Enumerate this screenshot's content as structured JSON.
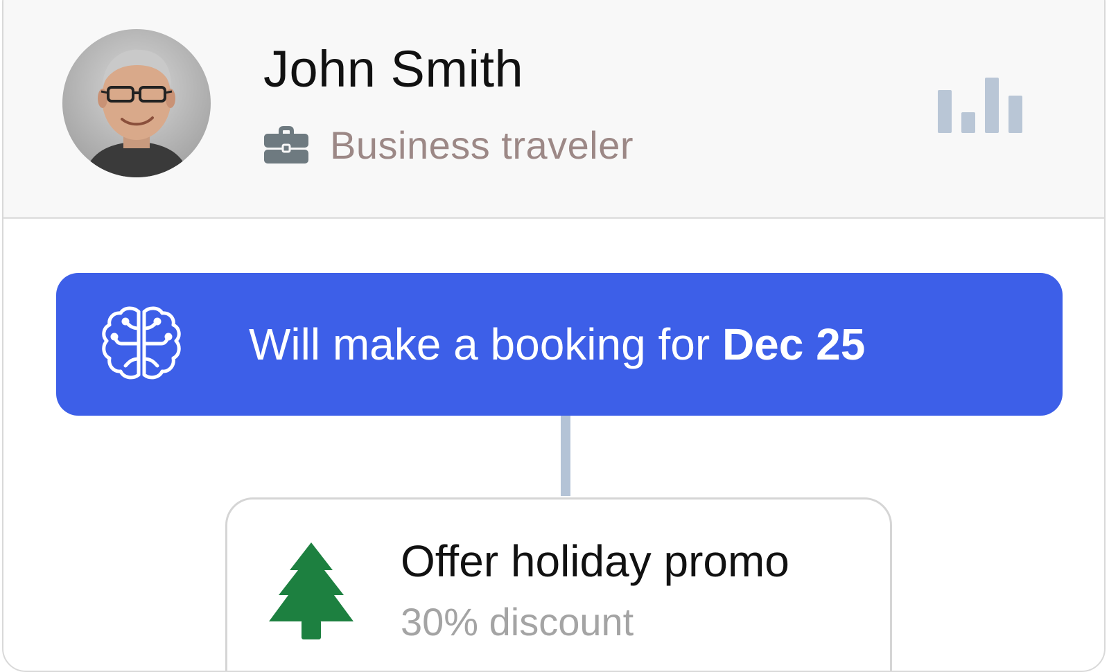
{
  "profile": {
    "name": "John Smith",
    "role": "Business traveler",
    "role_icon": "briefcase-icon",
    "avatar": "user-photo-avatar",
    "stats_icon": "bar-chart-icon"
  },
  "prediction": {
    "icon": "brain-icon",
    "text_prefix": "Will make a booking for ",
    "text_highlight": "Dec 25"
  },
  "offer": {
    "icon": "pine-tree-icon",
    "title": "Offer holiday promo",
    "subtitle": "30% discount"
  },
  "colors": {
    "accent": "#3d5fe8",
    "tree_green": "#1d8040",
    "connector": "#b4c3d6",
    "role_text": "#9c8886",
    "muted_icon": "#b9c6d6"
  }
}
